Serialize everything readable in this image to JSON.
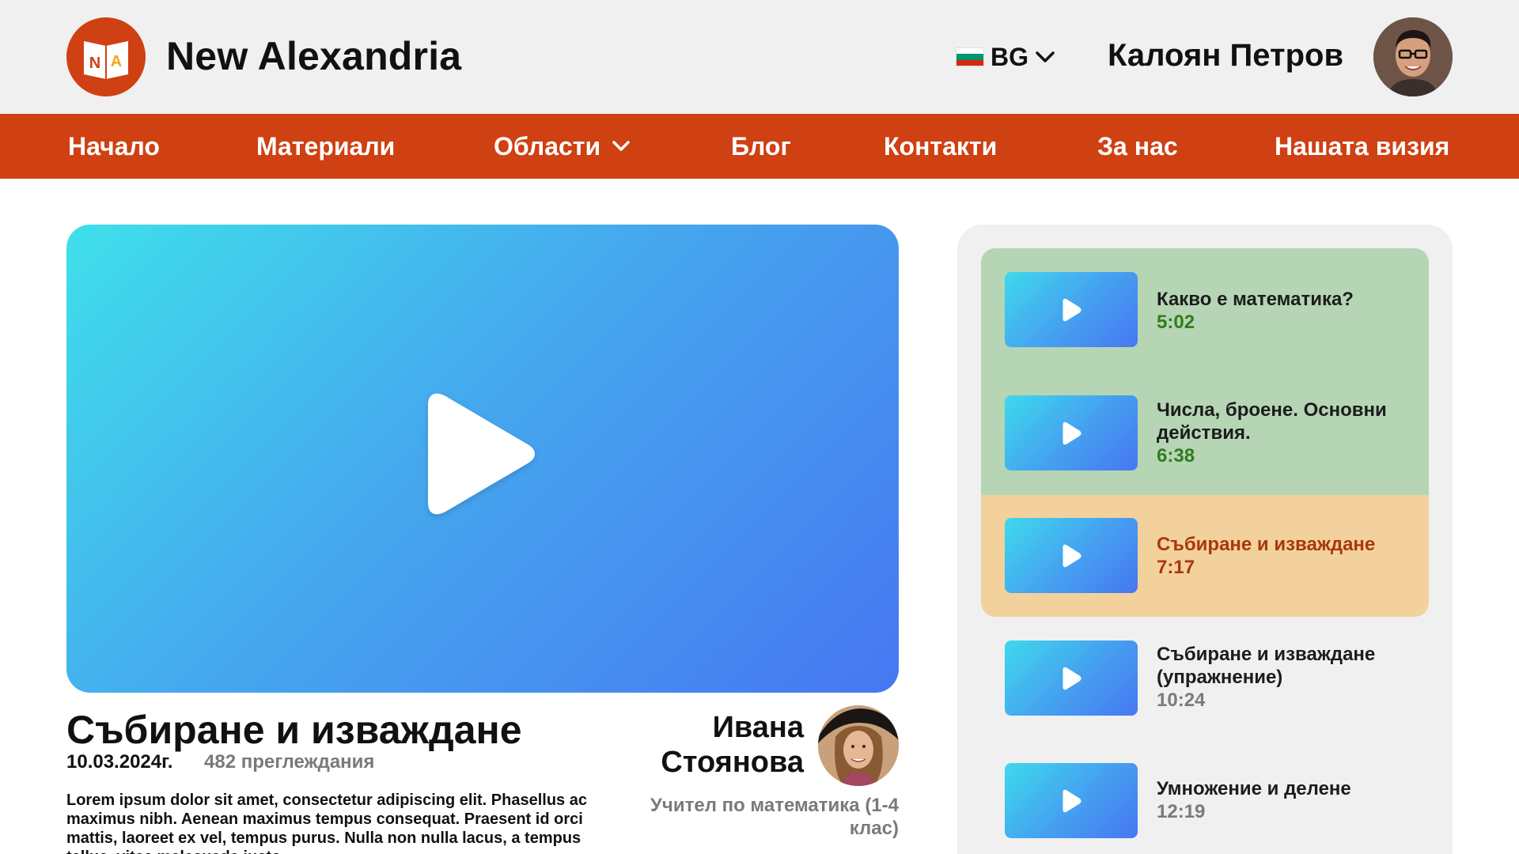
{
  "header": {
    "logo_letters": [
      "N",
      "A"
    ],
    "brand": "New Alexandria",
    "language": {
      "code": "BG",
      "flag_colors": [
        "#ffffff",
        "#00966e",
        "#d62612"
      ]
    },
    "user_name": "Калоян Петров"
  },
  "nav": {
    "items": [
      {
        "label": "Начало"
      },
      {
        "label": "Материали"
      },
      {
        "label": "Области",
        "has_dropdown": true
      },
      {
        "label": "Блог"
      },
      {
        "label": "Контакти"
      },
      {
        "label": "За нас"
      },
      {
        "label": "Нашата визия"
      }
    ]
  },
  "video": {
    "title": "Събиране и изваждане",
    "date": "10.03.2024г.",
    "views": "482 преглеждания",
    "description": "Lorem ipsum dolor sit amet, consectetur adipiscing elit. Phasellus ac maximus nibh. Aenean maximus tempus consequat. Praesent id orci mattis, laoreet ex vel, tempus purus. Nulla non nulla lacus, a tempus tellus, vitae malesuada justo."
  },
  "teacher": {
    "name": "Ивана Стоянова",
    "role": "Учител по математика (1-4 клас)"
  },
  "playlist": [
    {
      "title": "Какво е математика?",
      "duration": "5:02",
      "state": "watched"
    },
    {
      "title": "Числа, броене. Основни действия.",
      "duration": "6:38",
      "state": "watched"
    },
    {
      "title": "Събиране и изваждане",
      "duration": "7:17",
      "state": "current"
    },
    {
      "title": "Събиране и изваждане (упражнение)",
      "duration": "10:24",
      "state": "upcoming"
    },
    {
      "title": "Умножение и делене",
      "duration": "12:19",
      "state": "upcoming"
    }
  ],
  "colors": {
    "brand": "#cf4012",
    "watched_bg": "#b5d5b4",
    "watched_time": "#2f7d1e",
    "current_bg": "#f3d19c",
    "current_text": "#a8380e",
    "upcoming_time": "#7a7a7a"
  }
}
